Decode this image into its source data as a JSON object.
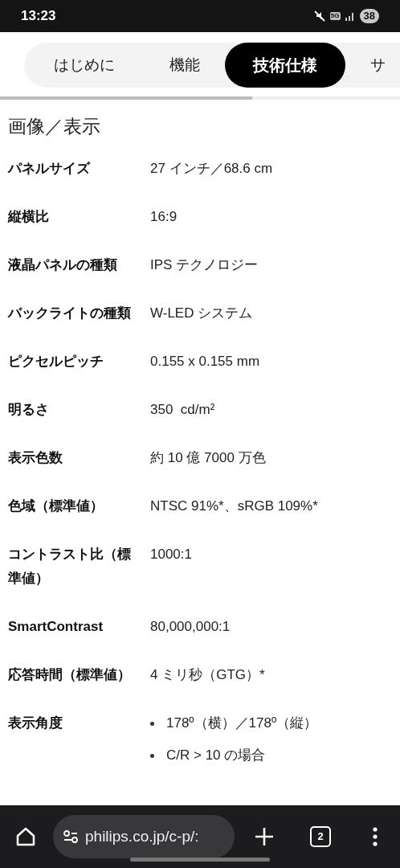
{
  "status_bar": {
    "time": "13:23",
    "network": "5G",
    "battery": "38"
  },
  "tabs": [
    {
      "label": "はじめに",
      "selected": false
    },
    {
      "label": "機能",
      "selected": false
    },
    {
      "label": "技術仕様",
      "selected": true
    },
    {
      "label": "サ",
      "selected": false
    }
  ],
  "scroll_progress": {
    "level": 0.63
  },
  "section": {
    "title": "画像／表示",
    "rows": [
      {
        "label": "パネルサイズ",
        "value": "27 インチ／68.6 cm"
      },
      {
        "label": "縦横比",
        "value": "16:9"
      },
      {
        "label": "液晶パネルの種類",
        "value": "IPS テクノロジー"
      },
      {
        "label": "バックライトの種類",
        "value": "W-LED システム"
      },
      {
        "label": "ピクセルピッチ",
        "value": "0.155 x 0.155 mm"
      },
      {
        "label": "明るさ",
        "value": "350  cd/m²"
      },
      {
        "label": "表示色数",
        "value": "約 10 億 7000 万色"
      },
      {
        "label": "色域（標準値）",
        "value": "NTSC 91%*、sRGB 109%*"
      },
      {
        "label": "コントラスト比（標準値）",
        "value": "1000:1"
      },
      {
        "label": "SmartContrast",
        "value": "80,000,000:1"
      },
      {
        "label": "応答時間（標準値）",
        "value": "4 ミリ秒（GTG）*"
      },
      {
        "label": "表示角度",
        "bullets": [
          "178º（横）／178º（縦）",
          "C/R > 10 の場合"
        ]
      }
    ]
  },
  "browser_bar": {
    "url": "philips.co.jp/c-p/:",
    "tab_count": "2"
  }
}
